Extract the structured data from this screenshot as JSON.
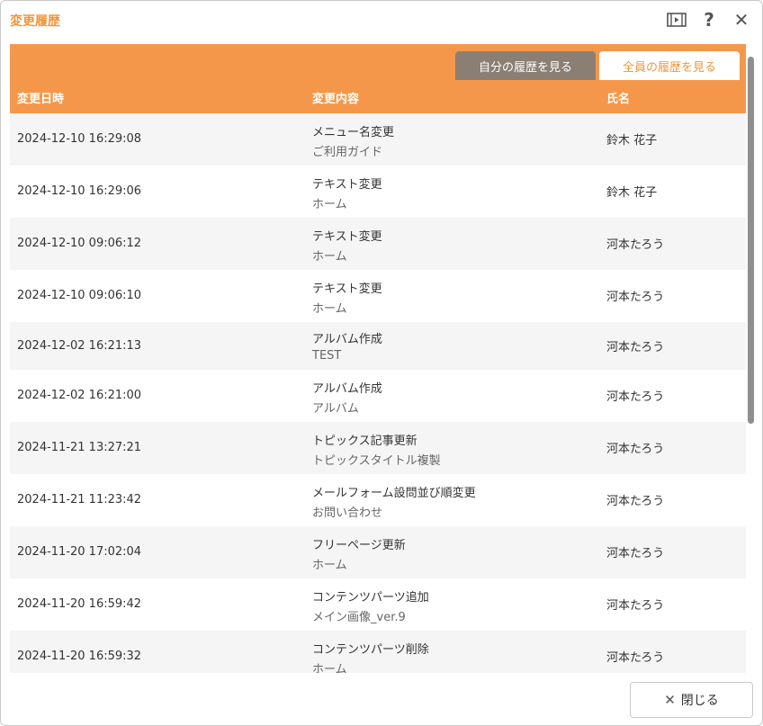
{
  "window": {
    "title": "変更履歴"
  },
  "tabs": {
    "mine": "自分の履歴を見る",
    "all": "全員の履歴を見る"
  },
  "columns": {
    "date": "変更日時",
    "action": "変更内容",
    "name": "氏名"
  },
  "rows": [
    {
      "date": "2024-12-10 16:29:08",
      "action": "メニュー名変更",
      "target": "ご利用ガイド",
      "name": "鈴木 花子"
    },
    {
      "date": "2024-12-10 16:29:06",
      "action": "テキスト変更",
      "target": "ホーム",
      "name": "鈴木 花子"
    },
    {
      "date": "2024-12-10 09:06:12",
      "action": "テキスト変更",
      "target": "ホーム",
      "name": "河本たろう"
    },
    {
      "date": "2024-12-10 09:06:10",
      "action": "テキスト変更",
      "target": "ホーム",
      "name": "河本たろう"
    },
    {
      "date": "2024-12-02 16:21:13",
      "action": "アルバム作成",
      "target": "TEST",
      "name": "河本たろう"
    },
    {
      "date": "2024-12-02 16:21:00",
      "action": "アルバム作成",
      "target": "アルバム",
      "name": "河本たろう"
    },
    {
      "date": "2024-11-21 13:27:21",
      "action": "トピックス記事更新",
      "target": "トピックスタイトル複製",
      "name": "河本たろう"
    },
    {
      "date": "2024-11-21 11:23:42",
      "action": "メールフォーム設問並び順変更",
      "target": "お問い合わせ",
      "name": "河本たろう"
    },
    {
      "date": "2024-11-20 17:02:04",
      "action": "フリーページ更新",
      "target": "ホーム",
      "name": "河本たろう"
    },
    {
      "date": "2024-11-20 16:59:42",
      "action": "コンテンツパーツ追加",
      "target": "メイン画像_ver.9",
      "name": "河本たろう"
    },
    {
      "date": "2024-11-20 16:59:32",
      "action": "コンテンツパーツ削除",
      "target": "ホーム",
      "name": "河本たろう"
    }
  ],
  "footer": {
    "close_label": "閉じる"
  },
  "icons": {
    "film": "film-icon",
    "help": "help-icon",
    "close": "close-icon"
  },
  "colors": {
    "accent": "#f5974a",
    "title": "#f0953a",
    "tab_inactive": "#8b7f74"
  }
}
